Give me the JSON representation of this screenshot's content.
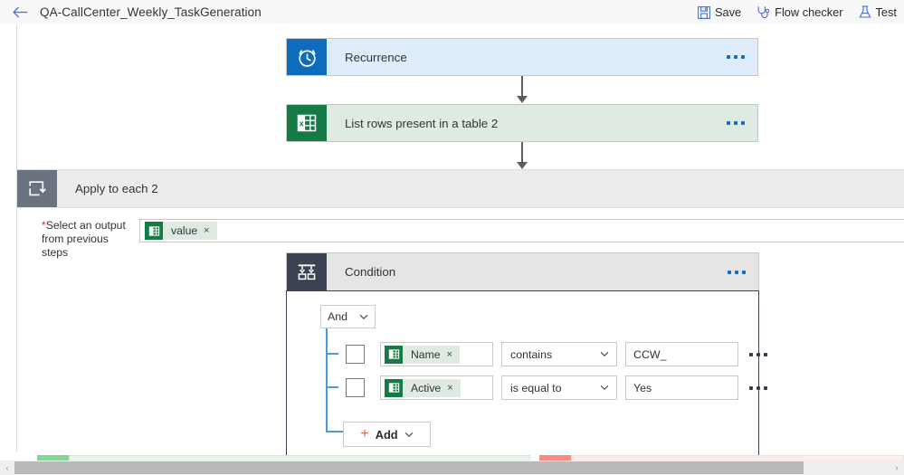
{
  "topbar": {
    "back_icon": "arrow-left-icon",
    "title": "QA-CallCenter_Weekly_TaskGeneration",
    "commands": [
      {
        "label": "Save",
        "icon": "save-icon"
      },
      {
        "label": "Flow checker",
        "icon": "stethoscope-icon"
      },
      {
        "label": "Test",
        "icon": "flask-icon"
      }
    ]
  },
  "flow": {
    "trigger": {
      "title": "Recurrence",
      "icon": "alarm-clock-icon",
      "icon_bg": "#0f6cbd",
      "body_bg": "#dfecfb",
      "menu": "..."
    },
    "action_listrows": {
      "title": "List rows present in a table 2",
      "icon": "excel-icon",
      "icon_bg": "#147b45",
      "body_bg": "#dfeae2",
      "menu": "..."
    },
    "apply_to_each": {
      "title": "Apply to each 2",
      "icon": "loop-icon",
      "icon_bg": "#6b7280",
      "field": {
        "required_marker": "*",
        "label_line1": "Select an output",
        "label_line2": "from previous steps",
        "token": {
          "text": "value",
          "icon": "excel-icon",
          "remove": "×"
        }
      }
    },
    "condition": {
      "title": "Condition",
      "icon": "condition-icon",
      "icon_bg": "#3b4252",
      "body_bg": "#e5e5e5",
      "menu": "...",
      "group_operator": {
        "value": "And",
        "chevron": "chevron-down-icon"
      },
      "rows": [
        {
          "checked": false,
          "token": {
            "text": "Name",
            "icon": "excel-icon",
            "remove": "×"
          },
          "operator": "contains",
          "value": "CCW_",
          "menu": "..."
        },
        {
          "checked": false,
          "token": {
            "text": "Active",
            "icon": "excel-icon",
            "remove": "×"
          },
          "operator": "is equal to",
          "value": "Yes",
          "menu": "..."
        }
      ],
      "add_button": {
        "plus": "+",
        "label": "Add",
        "chevron": "chevron-down-icon"
      },
      "branches": [
        {
          "name": "if-yes",
          "tab_color": "#83d495",
          "bar_color": "#e7f5ea"
        },
        {
          "name": "if-no",
          "tab_color": "#f98a80",
          "bar_color": "#fdeceb"
        }
      ]
    }
  },
  "scrollbar": {
    "left_arrow": "‹",
    "right_arrow": "›"
  }
}
